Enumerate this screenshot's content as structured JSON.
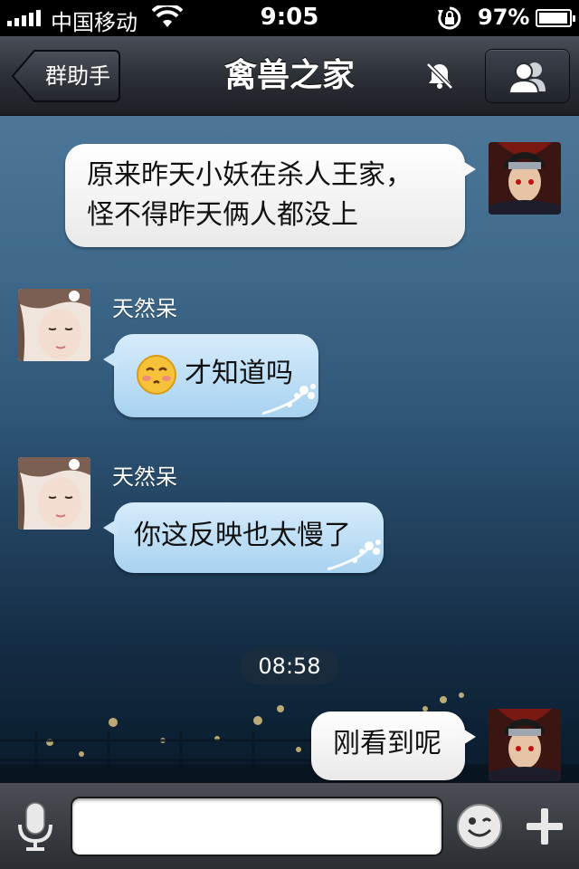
{
  "status_bar": {
    "carrier": "中国移动",
    "time": "9:05",
    "battery_percent": "97%",
    "battery_level": 0.97,
    "icons": [
      "signal-icon",
      "wifi-icon",
      "rotation-lock-icon",
      "battery-icon"
    ]
  },
  "nav": {
    "back_label": "群助手",
    "title": "禽兽之家",
    "icons": [
      "mute-icon",
      "members-icon"
    ]
  },
  "messages": [
    {
      "from": "me",
      "text_lines": [
        "原来昨天小妖在杀人王家，",
        "怪不得昨天俩人都没上"
      ]
    },
    {
      "from": "天然呆",
      "emoji": "blushing-face-icon",
      "text": "才知道吗"
    },
    {
      "from": "天然呆",
      "text": "你这反映也太慢了"
    },
    {
      "timestamp": "08:58"
    },
    {
      "from": "me",
      "text": "刚看到呢"
    }
  ],
  "input_bar": {
    "placeholder": "",
    "icons": [
      "microphone-icon",
      "emoji-icon",
      "plus-icon"
    ]
  },
  "colors": {
    "nav_bg": "#2c3037",
    "own_bubble": "#ffffff",
    "other_bubble": "#bfe0f7",
    "chat_bg_top": "#4d7799",
    "chat_bg_bottom": "#0a1b2c"
  }
}
